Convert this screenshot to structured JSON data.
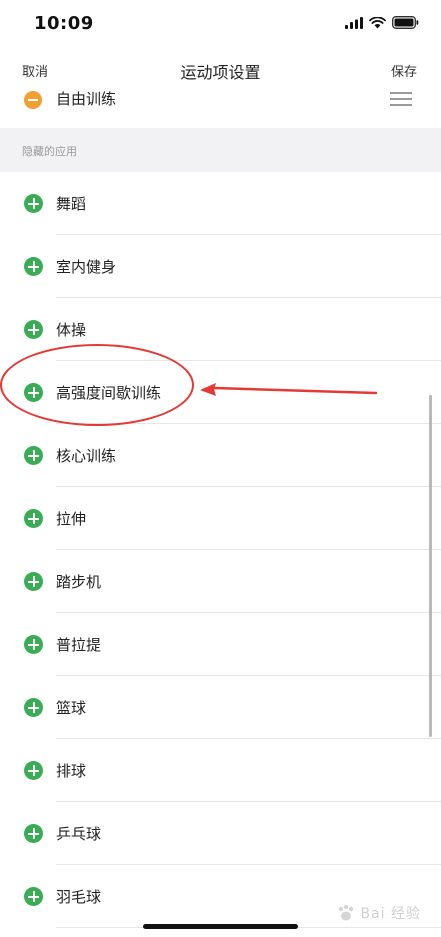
{
  "status_bar": {
    "time": "10:09"
  },
  "nav": {
    "left_label": "取消",
    "title": "运动项设置",
    "right_label": "保存"
  },
  "enabled_items": [
    {
      "label": "自由训练"
    }
  ],
  "section_header": "隐藏的应用",
  "hidden_apps": [
    {
      "label": "舞蹈"
    },
    {
      "label": "室内健身"
    },
    {
      "label": "体操"
    },
    {
      "label": "高强度间歇训练"
    },
    {
      "label": "核心训练"
    },
    {
      "label": "拉伸"
    },
    {
      "label": "踏步机"
    },
    {
      "label": "普拉提"
    },
    {
      "label": "篮球"
    },
    {
      "label": "排球"
    },
    {
      "label": "乒乓球"
    },
    {
      "label": "羽毛球"
    }
  ],
  "watermark": {
    "text": "Bai 经验"
  },
  "colors": {
    "add_icon": "#3bac56",
    "remove_icon": "#f0a030",
    "annotation": "#e53935"
  }
}
